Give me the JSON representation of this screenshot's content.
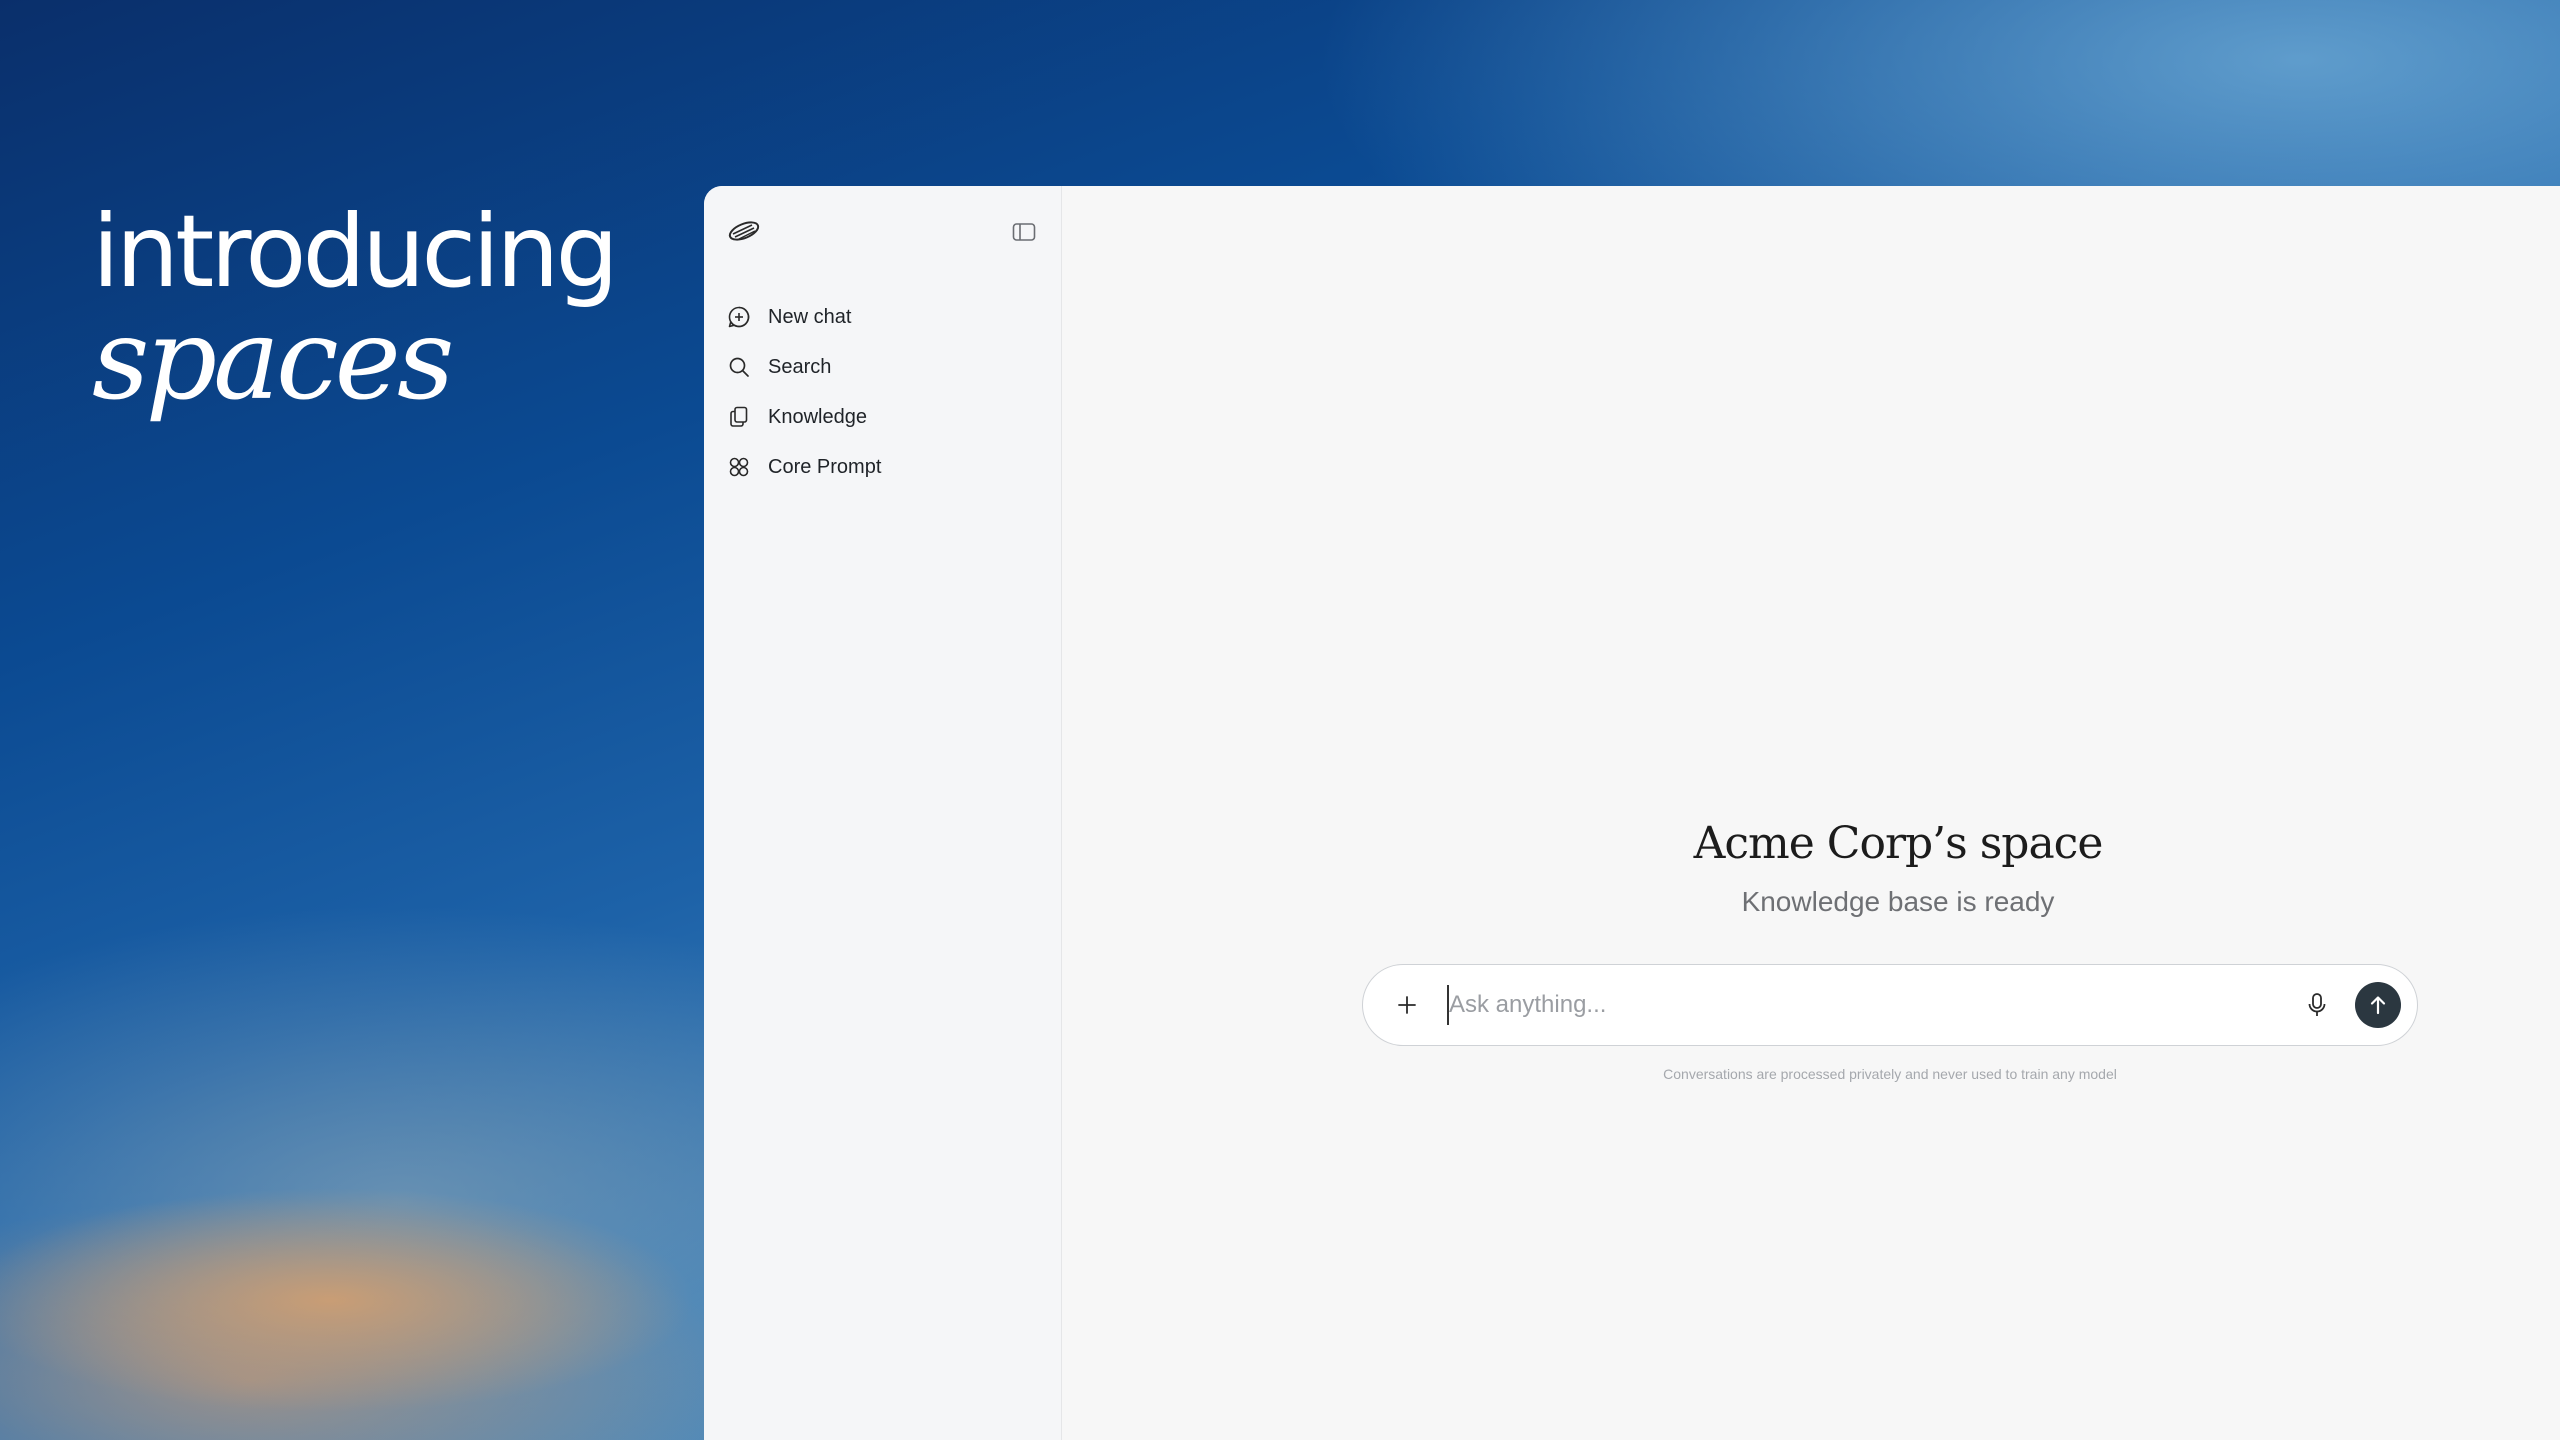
{
  "hero": {
    "line1": "introducing",
    "line2": "spaces"
  },
  "sidebar": {
    "items": [
      {
        "label": "New chat",
        "icon": "new-chat-icon"
      },
      {
        "label": "Search",
        "icon": "search-icon"
      },
      {
        "label": "Knowledge",
        "icon": "knowledge-icon"
      },
      {
        "label": "Core Prompt",
        "icon": "core-prompt-icon"
      }
    ]
  },
  "main": {
    "title": "Acme Corp’s space",
    "subtitle": "Knowledge base is ready",
    "composer": {
      "placeholder": "Ask anything...",
      "value": ""
    },
    "disclaimer": "Conversations are processed privately and never used to train any model"
  },
  "colors": {
    "send_button": "#2b3740",
    "panel": "#f7f7f7",
    "sidebar": "#f5f6f8"
  }
}
